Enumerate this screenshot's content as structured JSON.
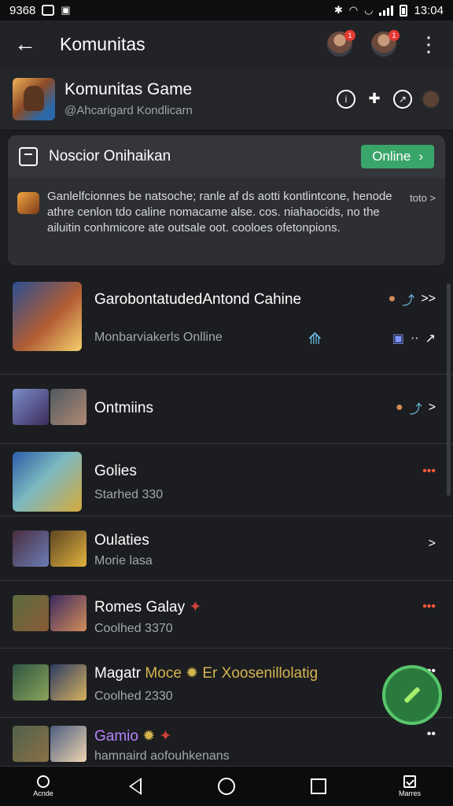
{
  "status_bar": {
    "left_text": "9368",
    "time": "13:04"
  },
  "app_bar": {
    "title": "Komunitas",
    "notification_badges": [
      "1",
      "1"
    ]
  },
  "community": {
    "name": "Komunitas Game",
    "handle": "@Ahcarigard Kondlicarn"
  },
  "notice": {
    "title": "Noscior Onihaikan",
    "button_label": "Online",
    "body": "Ganlelfcionnes be natsoche; ranle af ds aotti kontlintcone, henode athre cenlon tdo caline nomacame alse. cos. niahaocids, no the ailuitin conhmicore ate outsale oot. cooloes ofetonpions.",
    "more": "toto >"
  },
  "list": [
    {
      "title": "GarobontatudedAntond Cahine",
      "subtitle": "Monbarviakerls Onlline",
      "right_top": ">>",
      "right_bottom": "··"
    },
    {
      "title": "Ontmiins",
      "subtitle": "",
      "right_top": ">",
      "right_bottom": ""
    },
    {
      "title": "Golies",
      "subtitle": "Starhed 330",
      "right_top": "•••",
      "right_bottom": ""
    },
    {
      "title": "Oulaties",
      "subtitle": "Morie lasa",
      "right_top": ">",
      "right_bottom": ""
    },
    {
      "title": "Romes Galay",
      "subtitle": "Coolhed 3370",
      "right_top": "•••",
      "right_bottom": ""
    },
    {
      "title_prefix": "Magatr",
      "title_gold": "Moce",
      "title_suffix": "Er Xoosenillolatig",
      "subtitle": "Coolhed 2330",
      "right_top": "•••",
      "right_bottom": ""
    },
    {
      "title": "Gamio",
      "subtitle": "hamnaird aofouhkenans",
      "right_top": "••",
      "right_bottom": ""
    }
  ],
  "bottom_nav": {
    "left_label": "Acnde",
    "right_label": "Marres"
  }
}
